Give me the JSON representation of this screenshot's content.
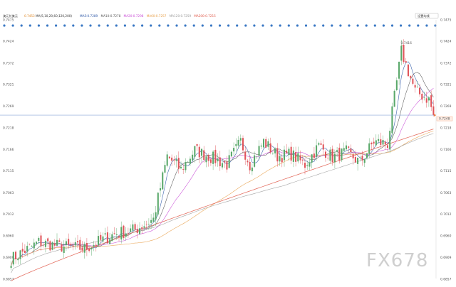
{
  "header": {
    "symbol": "澳元兑美元",
    "price_tag": "0.7453",
    "ma_params": "MA(5,10,20,60,120,200)",
    "ma_items": [
      {
        "label": "MA5:0.7289",
        "color": "#2a55a5"
      },
      {
        "label": "MA10:0.7278",
        "color": "#555555"
      },
      {
        "label": "MA20:0.7298",
        "color": "#c94bd6"
      },
      {
        "label": "MA60:0.7257",
        "color": "#e8a04a"
      },
      {
        "label": "MA120:0.7259",
        "color": "#9a9a9a"
      },
      {
        "label": "MA200:0.7215",
        "color": "#e05a4a"
      }
    ],
    "settings_label": "设置均线"
  },
  "watermark": "FX678",
  "chart_data": {
    "type": "candlestick",
    "y_ticks": [
      "0.7475",
      "0.7424",
      "0.7372",
      "0.7321",
      "0.7269",
      "0.7218",
      "0.7166",
      "0.7115",
      "0.7063",
      "0.7012",
      "0.6960",
      "0.6909",
      "0.6857"
    ],
    "ylim": [
      0.6857,
      0.7475
    ],
    "last_price_label": "0.7248",
    "last_price": 0.7248,
    "high_label": "0.7416",
    "high_value": 0.7416,
    "reference_line": 0.7248,
    "grid": false,
    "colors": {
      "up": "#59a86a",
      "down": "#e0545a",
      "ref_line": "#8aa7d8"
    },
    "series": [
      {
        "name": "MA5",
        "color": "#2a55a5"
      },
      {
        "name": "MA10",
        "color": "#555555"
      },
      {
        "name": "MA20",
        "color": "#c94bd6"
      },
      {
        "name": "MA60",
        "color": "#e8a04a"
      },
      {
        "name": "MA120",
        "color": "#9a9a9a"
      },
      {
        "name": "MA200",
        "color": "#e05a4a"
      }
    ],
    "candle_count": 185,
    "anchors": [
      [
        0,
        0.6905
      ],
      [
        12,
        0.6945
      ],
      [
        22,
        0.6935
      ],
      [
        32,
        0.693
      ],
      [
        45,
        0.6965
      ],
      [
        54,
        0.6975
      ],
      [
        62,
        0.7
      ],
      [
        68,
        0.715
      ],
      [
        74,
        0.7118
      ],
      [
        80,
        0.7165
      ],
      [
        86,
        0.715
      ],
      [
        94,
        0.713
      ],
      [
        100,
        0.7185
      ],
      [
        104,
        0.713
      ],
      [
        110,
        0.7185
      ],
      [
        116,
        0.715
      ],
      [
        122,
        0.7155
      ],
      [
        128,
        0.713
      ],
      [
        134,
        0.7175
      ],
      [
        140,
        0.7148
      ],
      [
        146,
        0.716
      ],
      [
        152,
        0.7135
      ],
      [
        158,
        0.7185
      ],
      [
        164,
        0.718
      ],
      [
        170,
        0.74
      ],
      [
        176,
        0.7305
      ],
      [
        182,
        0.7285
      ],
      [
        184,
        0.7248
      ]
    ]
  }
}
